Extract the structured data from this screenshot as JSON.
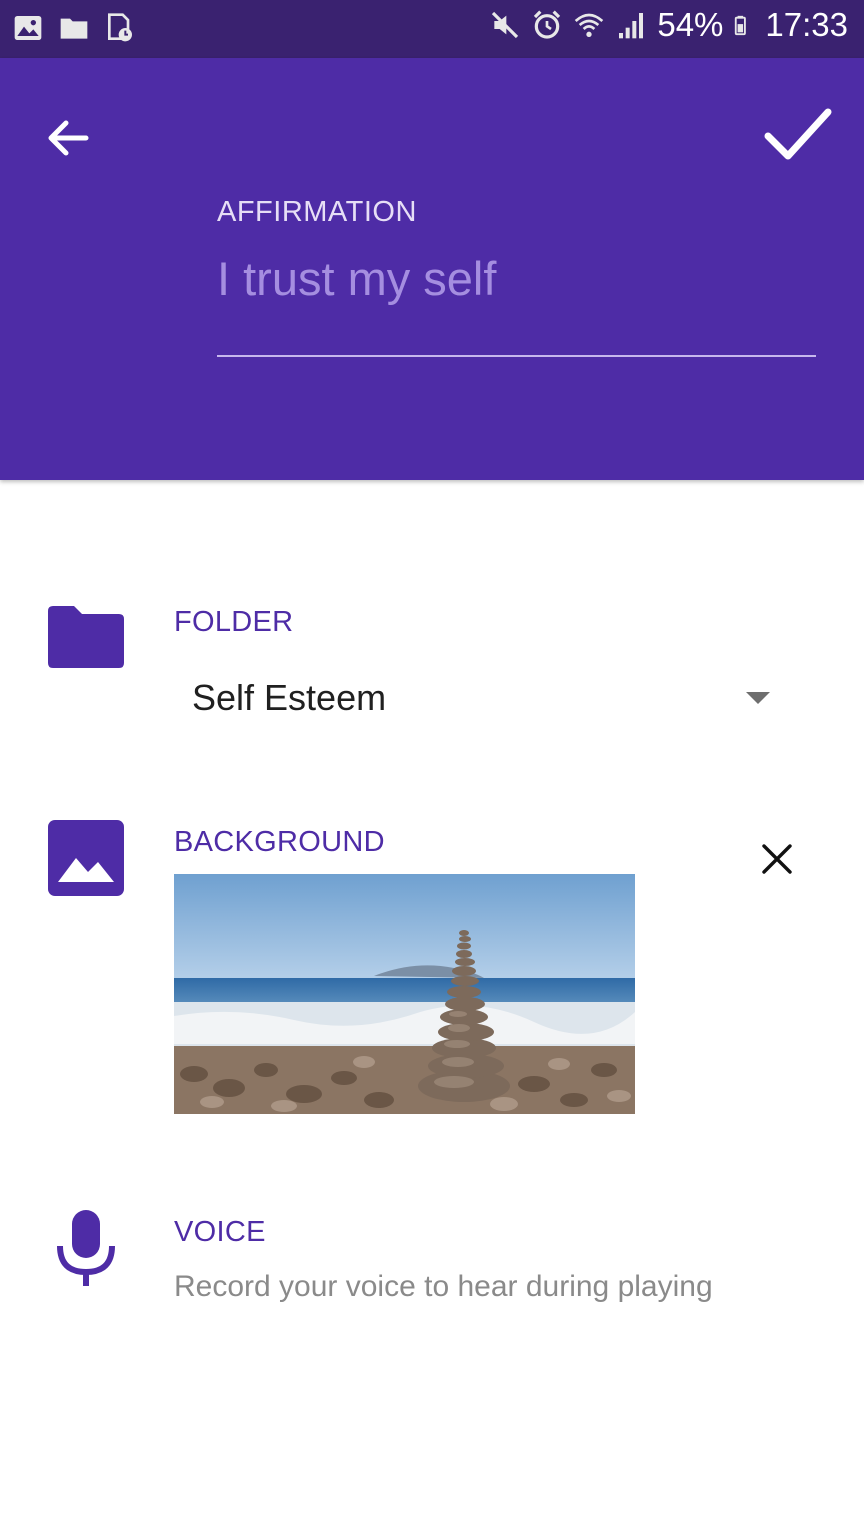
{
  "status_bar": {
    "battery": "54%",
    "time": "17:33",
    "left_icons": [
      "image-icon",
      "folder-icon",
      "file-clock-icon"
    ],
    "right_icons": [
      "mute-icon",
      "alarm-icon",
      "wifi-icon",
      "signal-icon",
      "battery-icon"
    ]
  },
  "header": {
    "back_icon": "arrow-left-icon",
    "save_icon": "checkmark-icon",
    "affirmation_label": "AFFIRMATION",
    "affirmation_value": "I trust my self"
  },
  "folder": {
    "label": "FOLDER",
    "selected": "Self Esteem",
    "icon": "folder-icon"
  },
  "background": {
    "label": "BACKGROUND",
    "icon": "image-icon",
    "remove_icon": "close-icon"
  },
  "voice": {
    "label": "VOICE",
    "description": "Record your voice to hear during playing",
    "icon": "microphone-icon"
  },
  "colors": {
    "status_bar": "#3a2270",
    "header": "#4e2ca6",
    "accent": "#4e2ca6",
    "placeholder": "#a58ee0"
  }
}
